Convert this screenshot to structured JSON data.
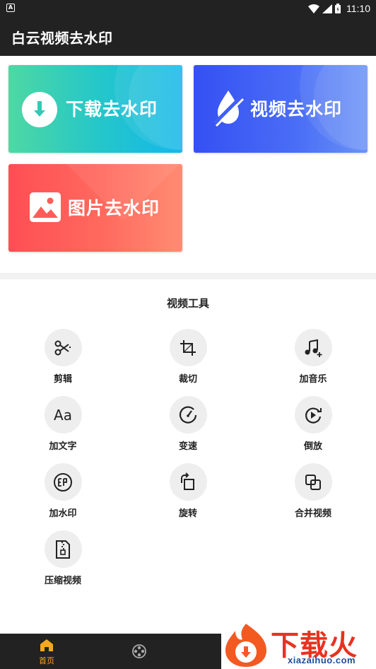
{
  "status_bar": {
    "time": "11:10",
    "notification_icon": "A"
  },
  "app_bar": {
    "title": "白云视频去水印"
  },
  "cards": {
    "download": {
      "label": "下载去水印",
      "icon": "download-circle-icon"
    },
    "video": {
      "label": "视频去水印",
      "icon": "water-drop-slash-icon"
    },
    "image": {
      "label": "图片去水印",
      "icon": "image-icon"
    }
  },
  "tools_section": {
    "title": "视频工具",
    "tools": [
      {
        "label": "剪辑",
        "icon": "scissors-icon"
      },
      {
        "label": "裁切",
        "icon": "crop-icon"
      },
      {
        "label": "加音乐",
        "icon": "music-add-icon"
      },
      {
        "label": "加文字",
        "icon": "text-icon"
      },
      {
        "label": "变速",
        "icon": "speedometer-icon"
      },
      {
        "label": "倒放",
        "icon": "reverse-play-icon"
      },
      {
        "label": "加水印",
        "icon": "watermark-icon"
      },
      {
        "label": "旋转",
        "icon": "rotate-icon"
      },
      {
        "label": "合并视频",
        "icon": "merge-icon"
      },
      {
        "label": "压缩视频",
        "icon": "zip-file-icon"
      }
    ]
  },
  "bottom_nav": {
    "home_label": "首页",
    "active_color": "#f5a81c"
  },
  "watermark": {
    "text": "下载火",
    "url": "xiazaihuo.com"
  },
  "colors": {
    "bar_bg": "#222222",
    "download_gradient": [
      "#4ed8a3",
      "#12b7ea"
    ],
    "video_gradient": [
      "#3550f3",
      "#6a93f7"
    ],
    "image_gradient": [
      "#ff4e54",
      "#ff8c72"
    ]
  }
}
